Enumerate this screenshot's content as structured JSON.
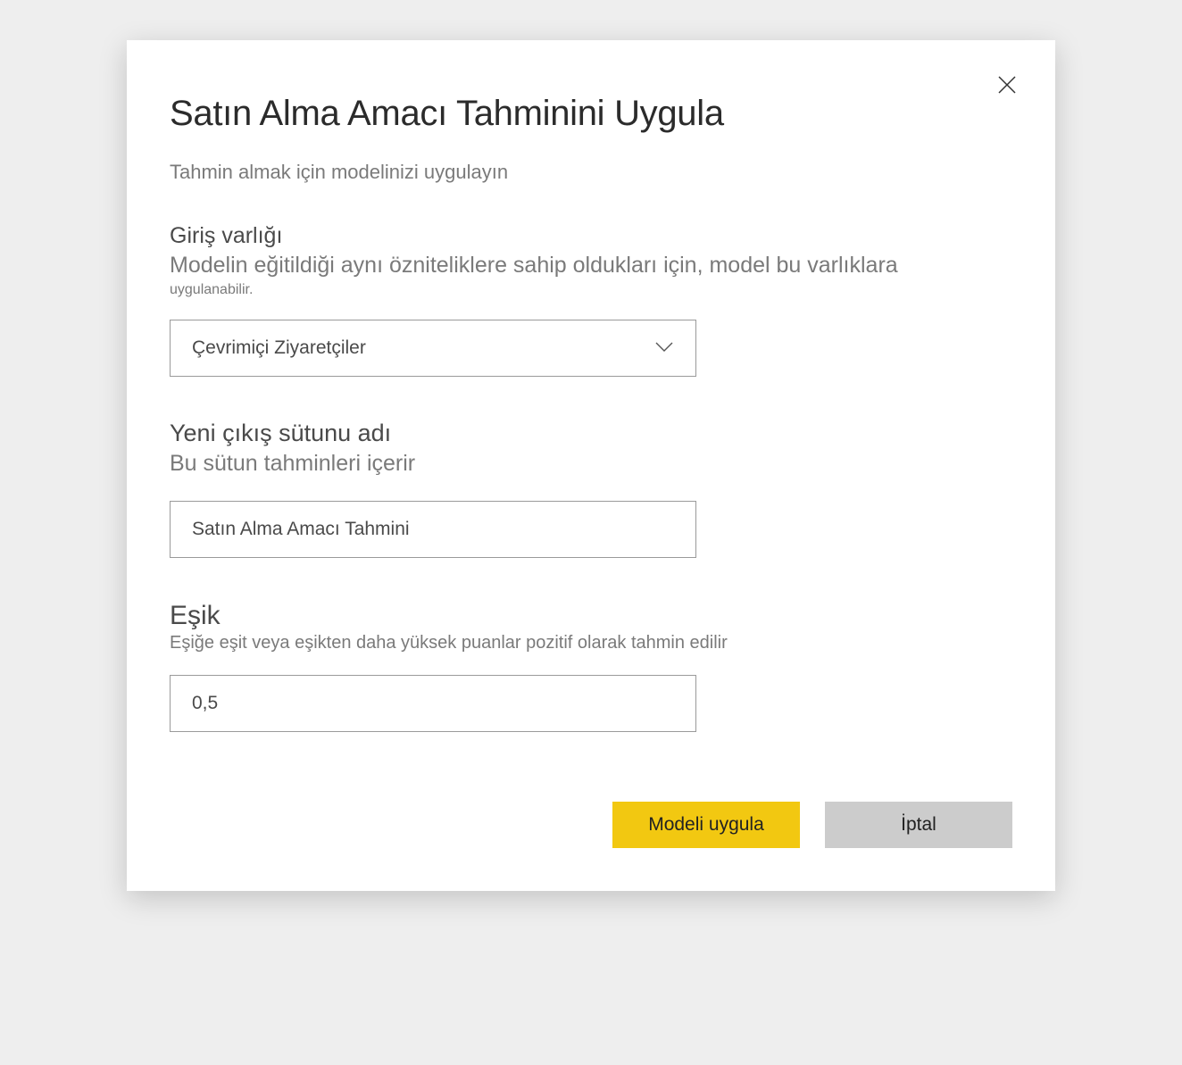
{
  "dialog": {
    "title": "Satın Alma Amacı Tahminini Uygula",
    "subtitle": "Tahmin almak için modelinizi uygulayın"
  },
  "input_entity": {
    "label": "Giriş varlığı",
    "hint_large": "Modelin eğitildiği aynı özniteliklere sahip oldukları için, model bu varlıklara",
    "hint_small": "uygulanabilir.",
    "selected": "Çevrimiçi Ziyaretçiler"
  },
  "output_column": {
    "label": "Yeni çıkış sütunu adı",
    "hint": "Bu sütun tahminleri içerir",
    "value": "Satın Alma Amacı Tahmini"
  },
  "threshold": {
    "label": "Eşik",
    "hint": "Eşiğe eşit veya eşikten daha yüksek puanlar pozitif olarak tahmin edilir",
    "value": "0,5"
  },
  "footer": {
    "apply": "Modeli uygula",
    "cancel": "İptal"
  }
}
